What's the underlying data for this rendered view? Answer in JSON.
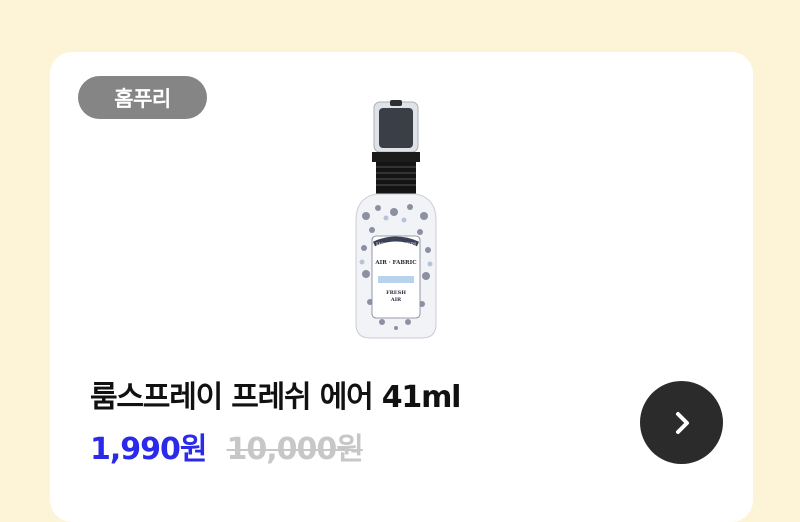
{
  "card": {
    "brand_badge": "홈푸리",
    "product_title": "룸스프레이 프레쉬 에어 41ml",
    "sale_price": "1,990원",
    "original_price": "10,000원",
    "product_image": {
      "alt": "HOME-POURRI AIR · FABRIC FRESH AIR spray bottle",
      "label_brand": "HOME·POURRI",
      "label_line1": "AIR · FABRIC",
      "label_line2": "FRESH",
      "label_line3": "AIR"
    },
    "go_button_icon": "chevron-right-icon"
  },
  "colors": {
    "page_background": "#fdf4d8",
    "card_background": "#ffffff",
    "badge_background": "#858585",
    "sale_price": "#2a2ae8",
    "original_price": "#c7c7c7",
    "go_button": "#2b2b2b"
  }
}
